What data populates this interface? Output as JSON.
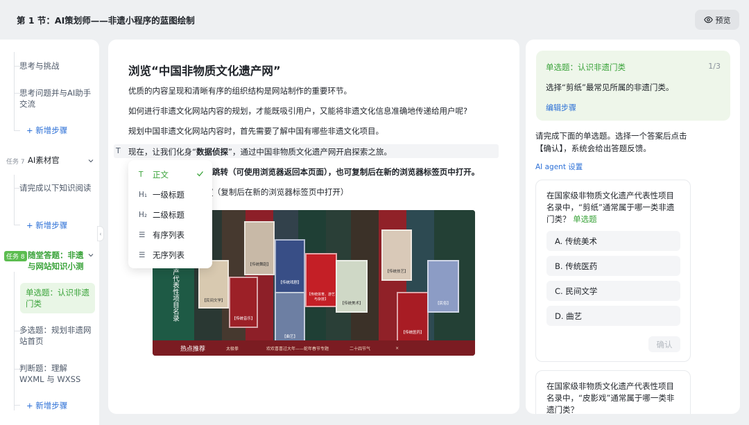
{
  "header": {
    "title": "第 1 节：AI策划师——非遗小程序的蓝图绘制",
    "preview_label": "预览"
  },
  "sidebar": {
    "items": [
      {
        "label": "思考与挑战"
      },
      {
        "label": "思考问题并与AI助手交流"
      },
      {
        "label": "+ 新增步骤"
      },
      {
        "badge": "任务 7",
        "label": "AI素材官"
      },
      {
        "label": "请完成以下知识阅读"
      },
      {
        "label": "+ 新增步骤"
      },
      {
        "badge": "任务 8",
        "label": "随堂答题：非遗与网站知识小测"
      },
      {
        "label": "单选题：认识非遗门类"
      },
      {
        "label": "多选题：规划非遗网站首页"
      },
      {
        "label": "判断题：理解 WXML 与 WXSS"
      },
      {
        "label": "+ 新增步骤"
      }
    ],
    "collapse_glyph": "‹"
  },
  "editor": {
    "heading": "浏览“中国非物质文化遗产网”",
    "p1": "优质的内容呈现和清晰有序的组织结构是网站制作的重要环节。",
    "p2": "如何进行非遗文化网站内容的规划，才能既吸引用户，又能将非遗文化信息准确地传递给用户呢?",
    "p3": "规划中国非遗文化网站内容时，首先需要了解中国有哪些非遗文化项目。",
    "p4_a": "现在，让我们化身“",
    "p4_b": "数据侦探",
    "p4_c": "”，通过中国非物质文化遗产网开启探索之旅。",
    "p5": "跳转（可使用浏览器返回本页面），也可复制后在新的浏览器标签页中打开。",
    "p6_link": "/",
    "p6_rest": "（复制后在新的浏览器标签页中打开）",
    "block_handle": "T"
  },
  "dropdown": {
    "items": [
      {
        "icon": "T",
        "label": "正文"
      },
      {
        "icon": "H₁",
        "label": "一级标题"
      },
      {
        "icon": "H₂",
        "label": "二级标题"
      },
      {
        "icon": "☰",
        "label": "有序列表"
      },
      {
        "icon": "☰",
        "label": "无序列表"
      }
    ]
  },
  "banner": {
    "vertical_title": "文化遗产代表性项目名录",
    "cards": [
      "【传统舞蹈】",
      "【民间文学】",
      "【传统音乐】",
      "【传统戏剧】",
      "【传统体育、游艺与杂技】",
      "【曲艺】",
      "【传统美术】",
      "【传统技艺】",
      "【传统医药】",
      "【民俗】"
    ],
    "footer_title": "热点推荐",
    "footer_items": [
      "太极拳",
      "欢欢喜喜过大年——蛇年春节专题",
      "二十四节气"
    ],
    "footer_close": "×"
  },
  "right": {
    "step_title": "单选题：认识非遗门类",
    "step_count": "1/3",
    "step_desc": "选择“剪纸”最常见所属的非遗门类。",
    "edit_step": "编辑步骤",
    "instruction": "请完成下面的单选题。选择一个答案后点击【确认】，系统会给出答题反馈。",
    "agent_settings": "AI agent 设置",
    "question": "在国家级非物质文化遗产代表性项目名录中，“剪纸”通常属于哪一类非遗门类？",
    "question_type": "单选题",
    "options": [
      "A. 传统美术",
      "B. 传统医药",
      "C. 民间文学",
      "D. 曲艺"
    ],
    "confirm": "确认",
    "question2": "在国家级非物质文化遗产代表性项目名录中，“皮影戏”通常属于哪一类非遗门类？"
  }
}
